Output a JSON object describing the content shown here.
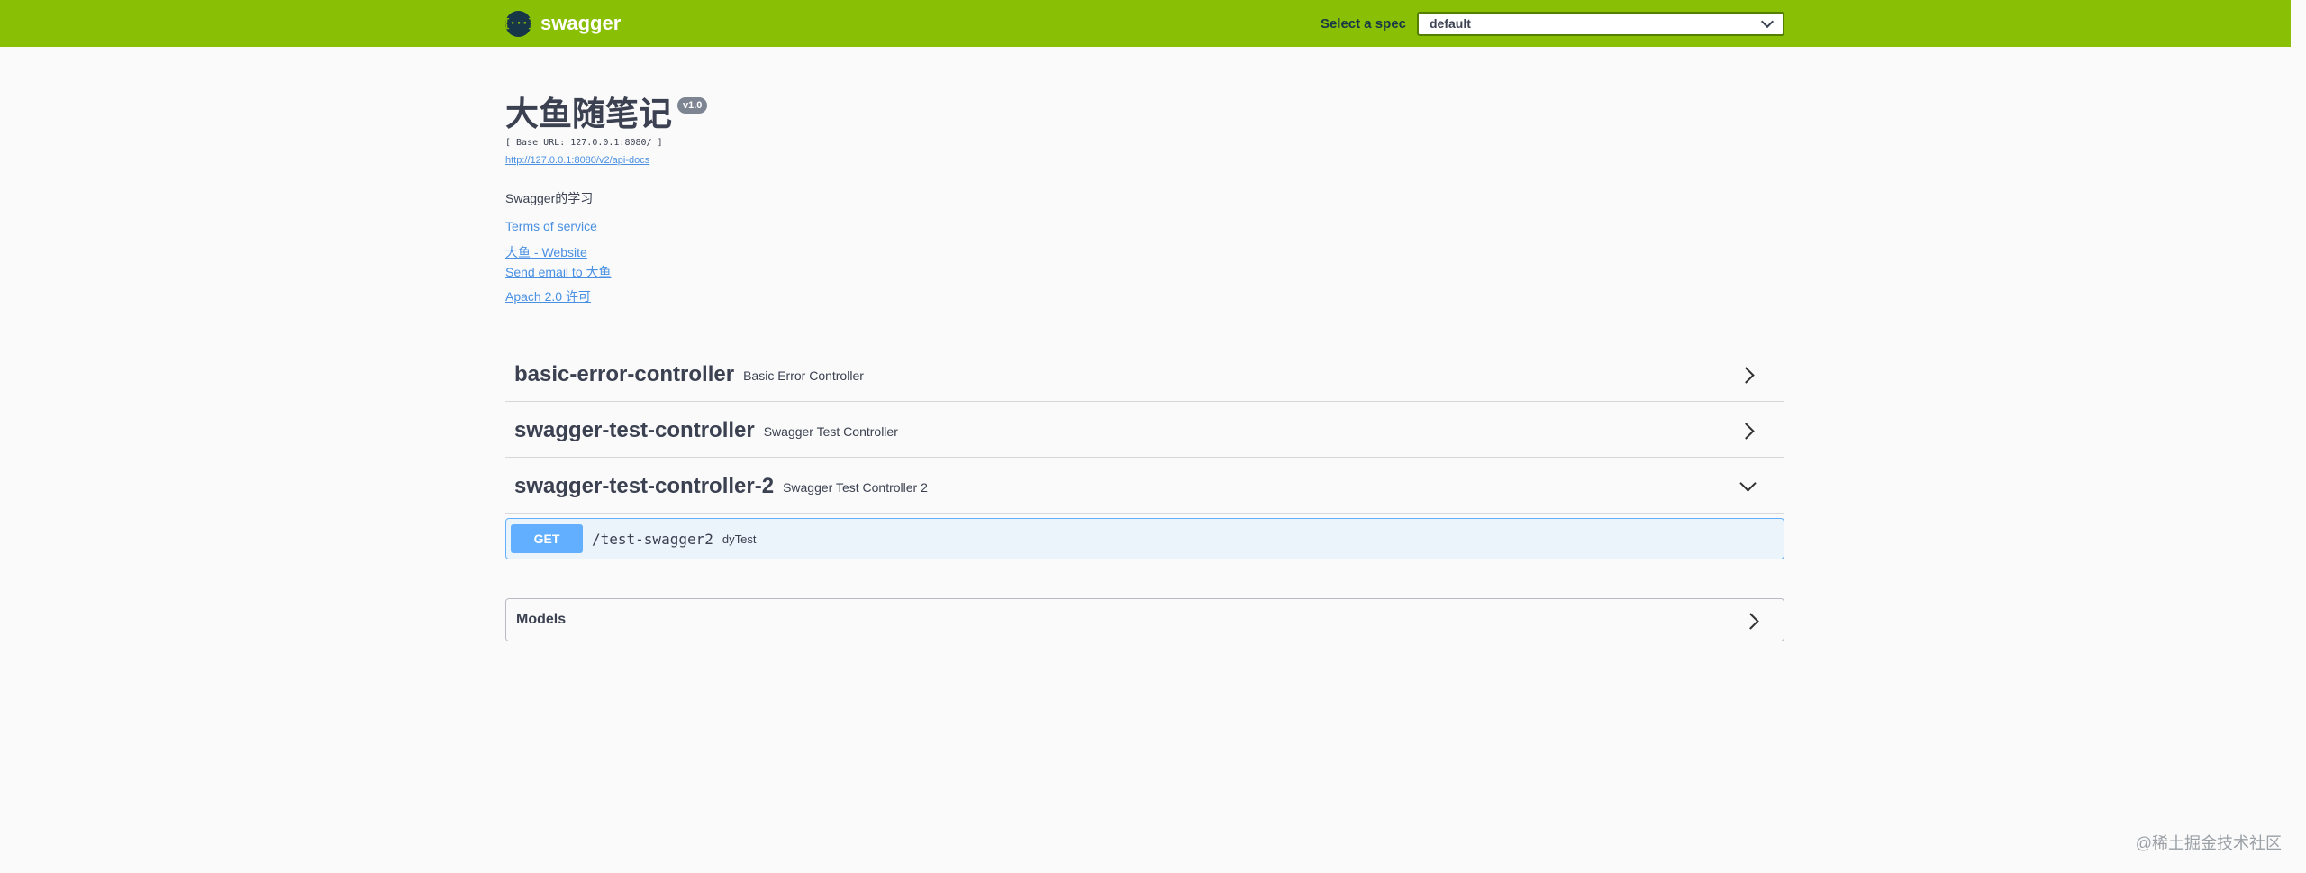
{
  "topbar": {
    "logo_glyph": "{···}",
    "brand": "swagger",
    "spec_label": "Select a spec",
    "spec_value": "default"
  },
  "info": {
    "title": "大鱼随笔记",
    "version": "v1.0",
    "base_url": "[ Base URL: 127.0.0.1:8080/ ]",
    "api_docs_link": "http://127.0.0.1:8080/v2/api-docs",
    "description": "Swagger的学习",
    "terms_link": "Terms of service",
    "website_link": "大鱼 - Website",
    "email_link": "Send email to 大鱼",
    "license_link": "Apach 2.0 许可"
  },
  "tags": [
    {
      "name": "basic-error-controller",
      "description": "Basic Error Controller",
      "expanded": false
    },
    {
      "name": "swagger-test-controller",
      "description": "Swagger Test Controller",
      "expanded": false
    },
    {
      "name": "swagger-test-controller-2",
      "description": "Swagger Test Controller 2",
      "expanded": true
    }
  ],
  "operation": {
    "method": "GET",
    "path": "/test-swagger2",
    "summary": "dyTest"
  },
  "models": {
    "title": "Models"
  },
  "watermark": "@稀土掘金技术社区",
  "colors": {
    "topbar": "#89bf04",
    "get_method": "#61affe",
    "link": "#4990e2"
  }
}
